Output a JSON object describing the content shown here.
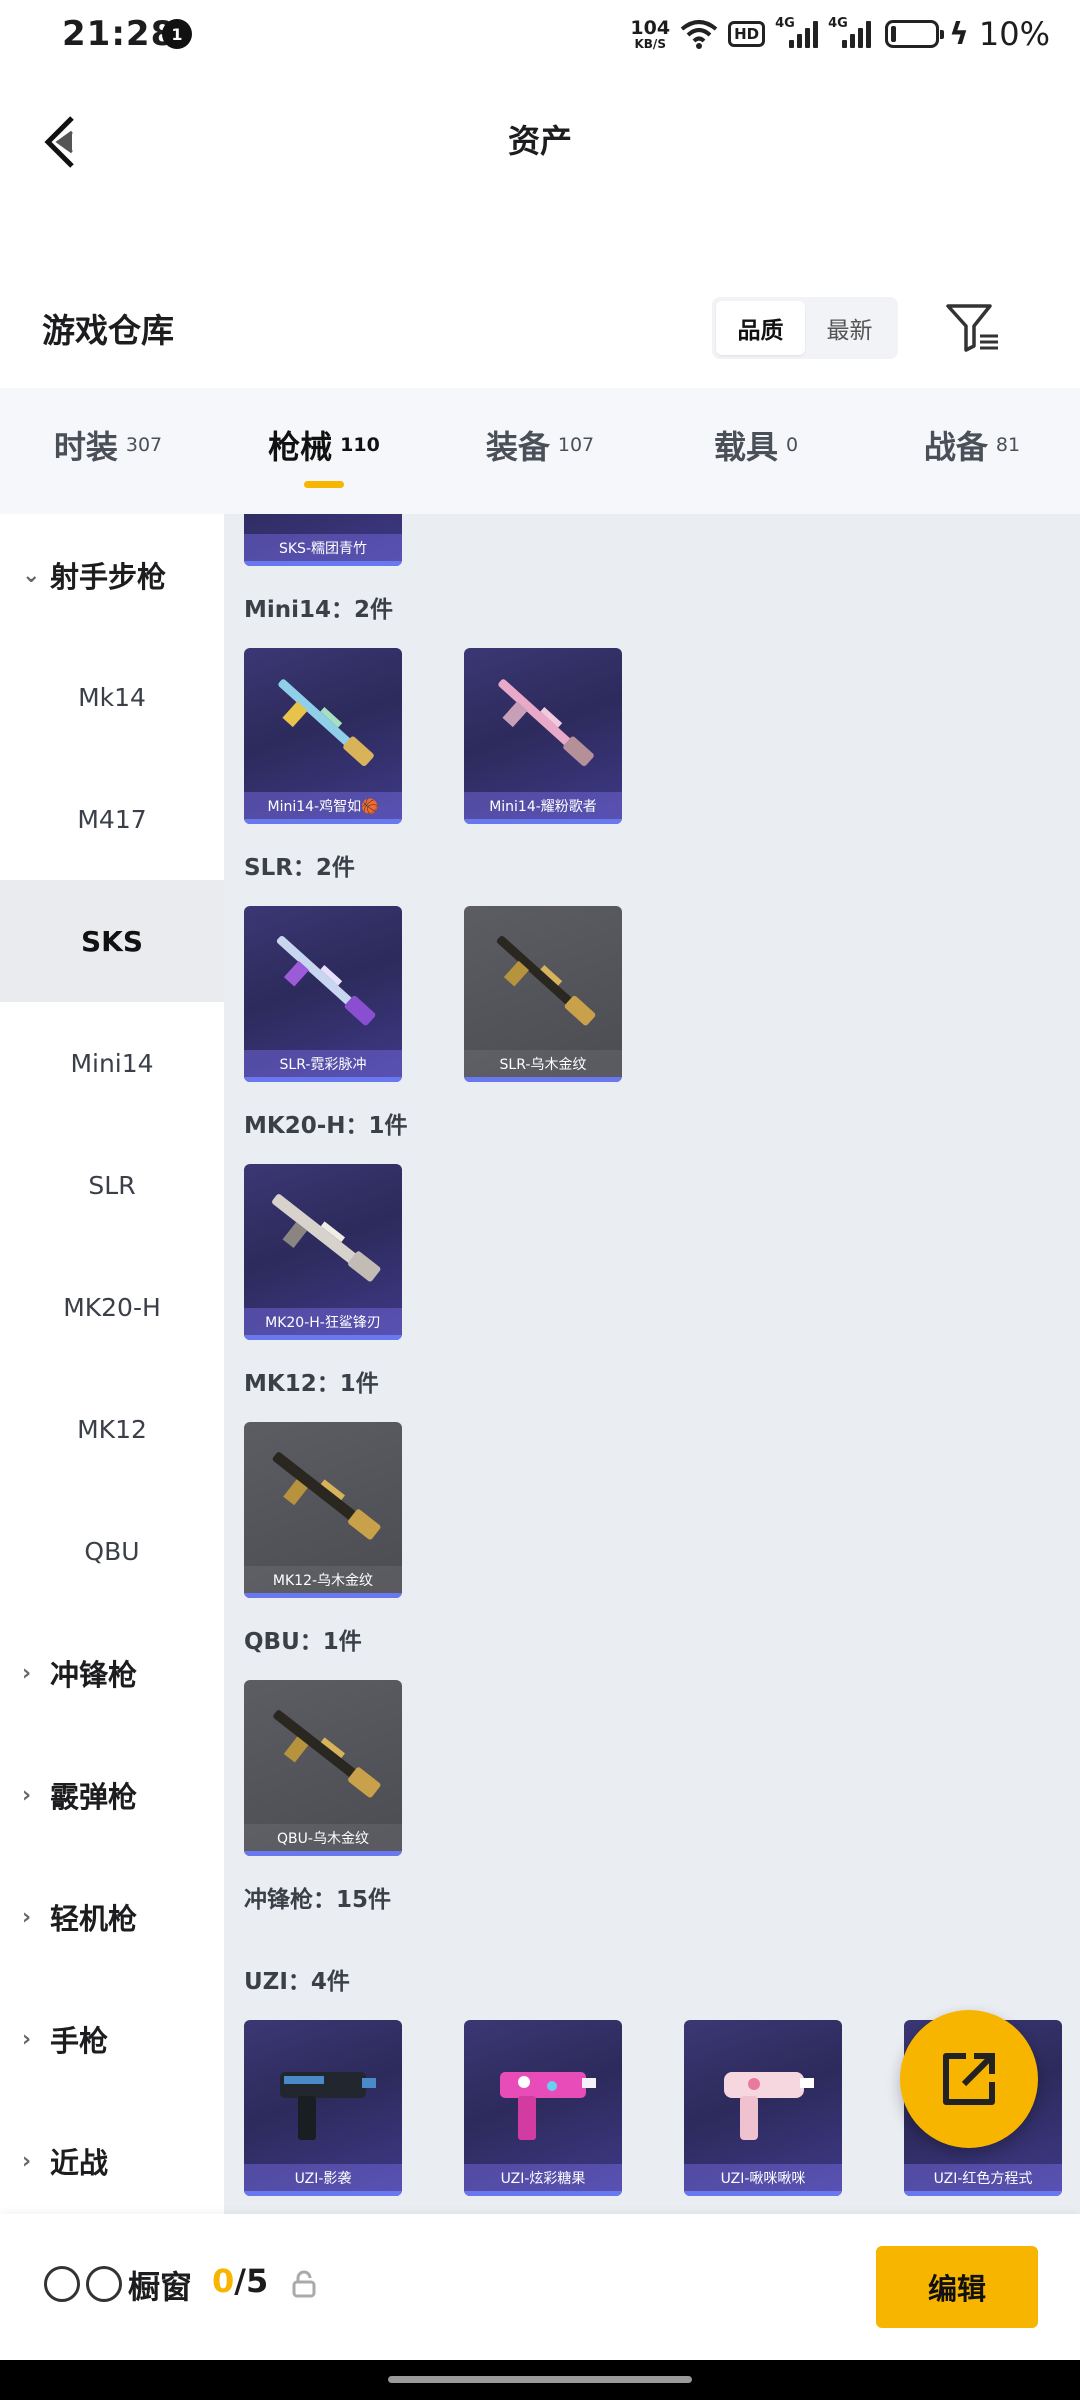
{
  "status_bar": {
    "time": "21:28",
    "notification_count": "1",
    "net_speed_value": "104",
    "net_speed_unit": "KB/S",
    "hd": "HD",
    "signal_tag_1": "4G",
    "signal_tag_2": "4G",
    "battery_percent": "10%",
    "battery_fill": 0.1
  },
  "header": {
    "title": "资产"
  },
  "section": {
    "title": "游戏仓库",
    "sort_options": [
      "品质",
      "最新"
    ]
  },
  "tabs": [
    {
      "label": "时装",
      "count": "307"
    },
    {
      "label": "枪械",
      "count": "110"
    },
    {
      "label": "装备",
      "count": "107"
    },
    {
      "label": "载具",
      "count": "0"
    },
    {
      "label": "战备",
      "count": "81"
    }
  ],
  "sidebar": {
    "category_open": "射手步枪",
    "subitems": [
      "Mk14",
      "M417",
      "SKS",
      "Mini14",
      "SLR",
      "MK20-H",
      "MK12",
      "QBU"
    ],
    "categories_closed": [
      "冲锋枪",
      "霰弹枪",
      "轻机枪",
      "手枪",
      "近战"
    ]
  },
  "content": {
    "partial_card_caption": "SKS-糯团青竹",
    "groups": [
      {
        "label": "Mini14：2件",
        "items": [
          "Mini14-鸡智如🏀",
          "Mini14-耀粉歌者"
        ]
      },
      {
        "label": "SLR：2件",
        "items": [
          "SLR-霓彩脉冲",
          "SLR-乌木金纹"
        ]
      },
      {
        "label": "MK20-H：1件",
        "items": [
          "MK20-H-狂鲨锋刃"
        ]
      },
      {
        "label": "MK12：1件",
        "items": [
          "MK12-乌木金纹"
        ]
      },
      {
        "label": "QBU：1件",
        "items": [
          "QBU-乌木金纹"
        ]
      },
      {
        "label": "冲锋枪：15件",
        "items": []
      },
      {
        "label": "UZI：4件",
        "items": [
          "UZI-影袭",
          "UZI-炫彩糖果",
          "UZI-啾咪啾咪",
          "UZI-红色方程式"
        ]
      }
    ]
  },
  "bottom_bar": {
    "showcase_label": "橱窗",
    "count_current": "0",
    "count_total": "/5",
    "edit_label": "编辑"
  },
  "colors": {
    "accent": "#f7b500",
    "purple_card": "#2d2a5c",
    "grey_card": "#4b4c52",
    "content_bg": "#eaedf2"
  }
}
